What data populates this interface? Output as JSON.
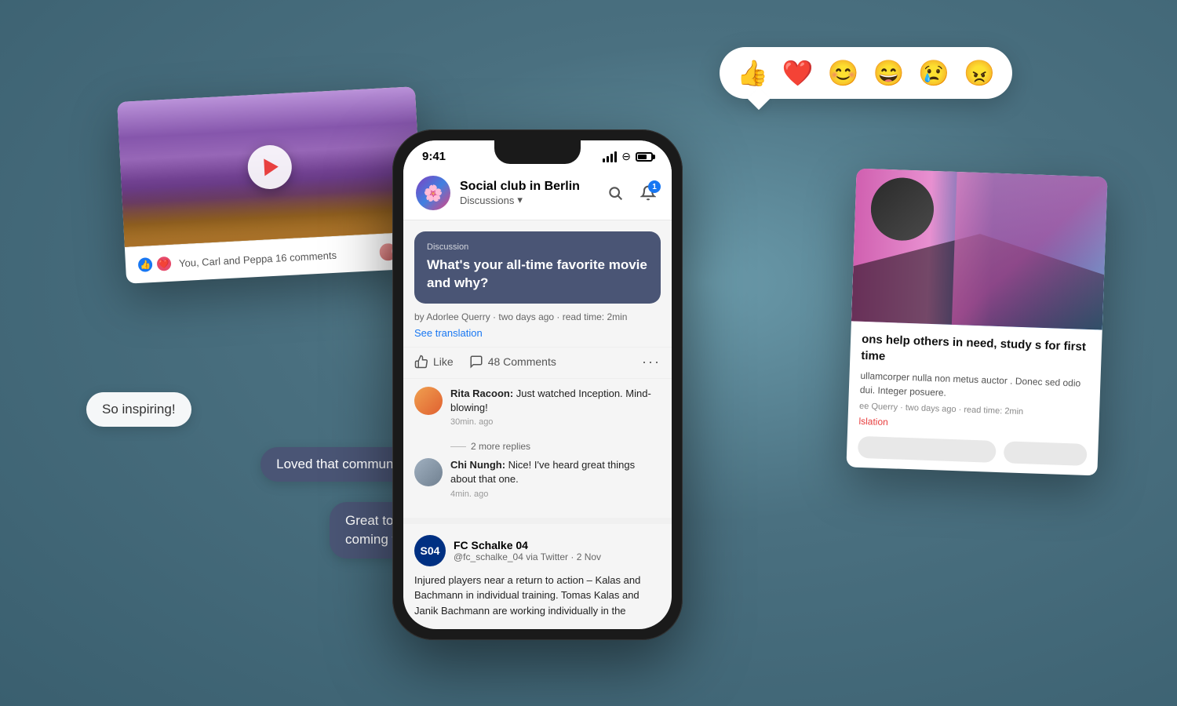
{
  "background": {
    "color": "#5a7a8a"
  },
  "reactions": {
    "emojis": [
      "👍",
      "❤️",
      "😊",
      "😄",
      "😢",
      "😠"
    ],
    "colors": [
      "#e05030",
      "#e84060",
      "#e08030",
      "#e09030",
      "#e07030",
      "#e04020"
    ]
  },
  "left_panel": {
    "footer_text": "You, Carl and Peppa",
    "comments_count": "16 comments"
  },
  "chat_bubbles": {
    "inspiring": "So inspiring!",
    "loved": "Loved that community post!",
    "great": "Great to see everyone coming together."
  },
  "phone": {
    "status_bar": {
      "time": "9:41",
      "signal": "●●●",
      "wifi": "wifi",
      "battery": "battery"
    },
    "header": {
      "group_name": "Social club in Berlin",
      "section": "Discussions",
      "notif_count": "1",
      "avatar_emoji": "🌸"
    },
    "discussion": {
      "label": "Discussion",
      "title": "What's your all-time favorite movie and why?",
      "meta": "by Adorlee Querry · two days ago · read time: 2min",
      "see_translation": "See translation",
      "like_label": "Like",
      "comments_count": "48 Comments"
    },
    "comments": [
      {
        "author": "Rita Racoon",
        "text": "Just watched Inception. Mind-blowing!",
        "time": "30min. ago",
        "more_replies": "2 more replies"
      },
      {
        "author": "Chi Nungh",
        "text": "Nice! I've heard great things about that one.",
        "time": "4min. ago"
      }
    ],
    "twitter_post": {
      "account_name": "FC Schalke 04",
      "handle": "@fc_schalke_04 via Twitter · 2 Nov",
      "text": "Injured players near a return to action – Kalas and Bachmann in individual training. Tomas Kalas and Janik Bachmann are working individually in the"
    }
  },
  "right_panel": {
    "article_title": "ons help others in need, study s for first time",
    "article_body": "ullamcorper nulla non metus auctor . Donec sed odio dui. Integer posuere.",
    "article_meta": "ee Querry · two days ago · read time: 2min",
    "see_translation": "lslation"
  }
}
